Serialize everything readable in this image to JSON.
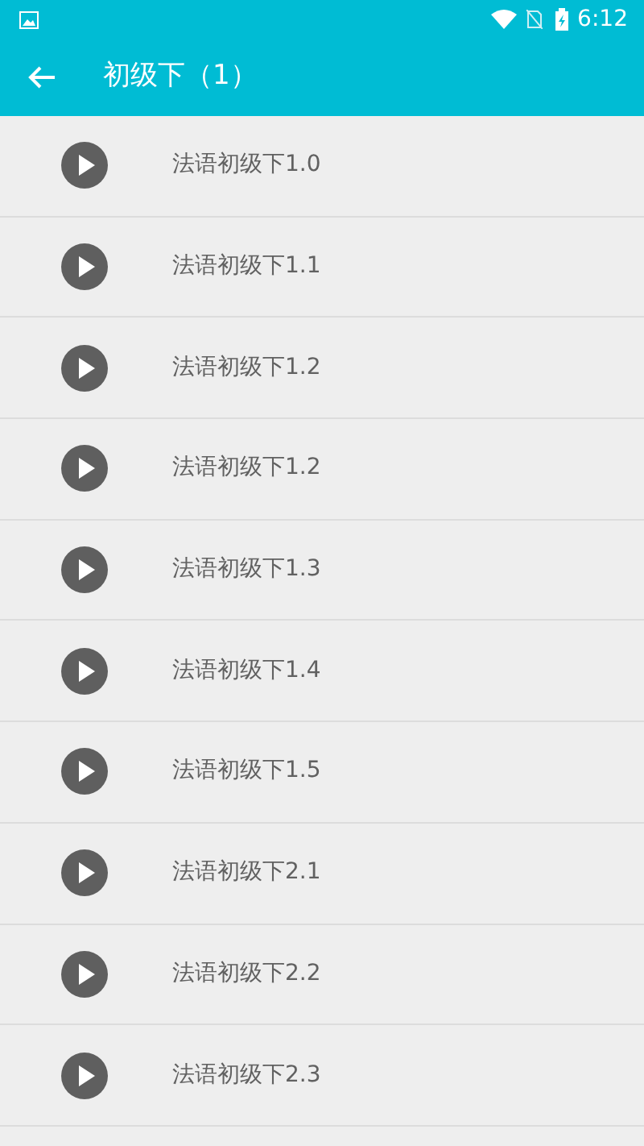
{
  "status_bar": {
    "time": "6:12"
  },
  "toolbar": {
    "title": "初级下（1）"
  },
  "items": [
    {
      "title": "法语初级下1.0"
    },
    {
      "title": "法语初级下1.1"
    },
    {
      "title": "法语初级下1.2"
    },
    {
      "title": "法语初级下1.2"
    },
    {
      "title": "法语初级下1.3"
    },
    {
      "title": "法语初级下1.4"
    },
    {
      "title": "法语初级下1.5"
    },
    {
      "title": "法语初级下2.1"
    },
    {
      "title": "法语初级下2.2"
    },
    {
      "title": "法语初级下2.3"
    }
  ]
}
